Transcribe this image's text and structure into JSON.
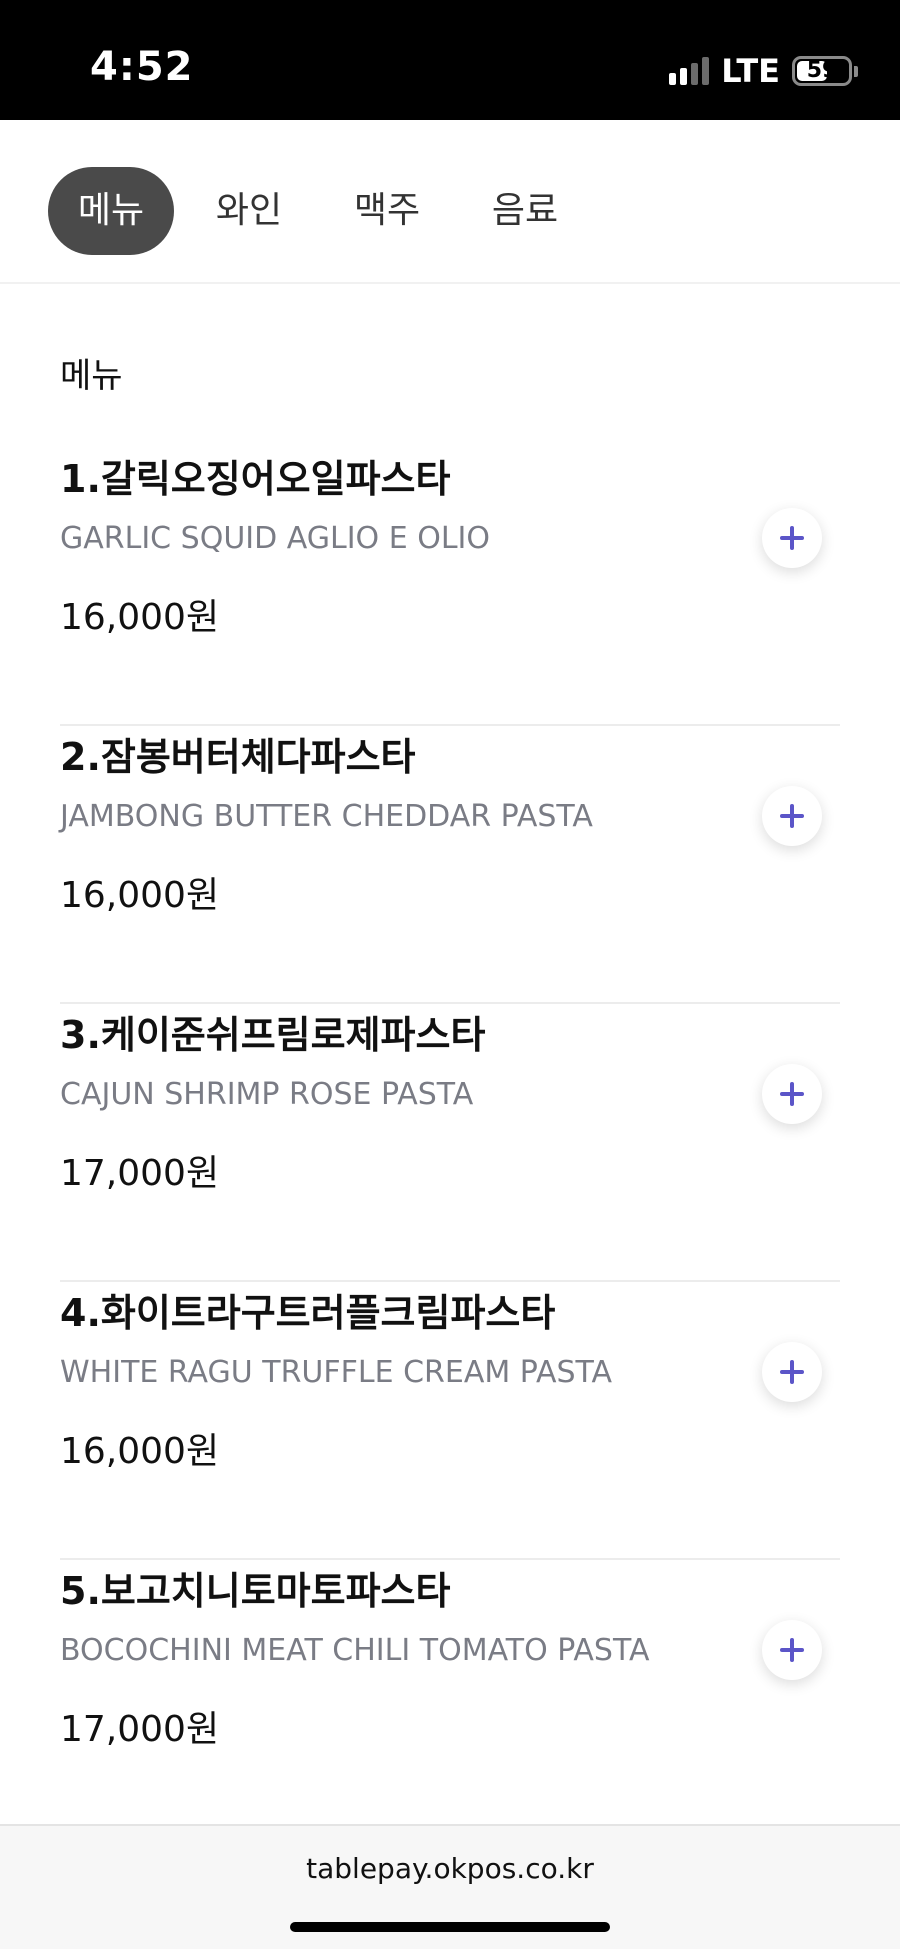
{
  "status_bar": {
    "time": "4:52",
    "network": "LTE",
    "battery": "59",
    "battery_level_pct": 59,
    "signal_bars_active": 2,
    "signal_bars_total": 4
  },
  "tabs": [
    {
      "label": "메뉴",
      "active": true
    },
    {
      "label": "와인",
      "active": false
    },
    {
      "label": "맥주",
      "active": false
    },
    {
      "label": "음료",
      "active": false
    }
  ],
  "section": {
    "title": "메뉴"
  },
  "menu_items": [
    {
      "name": "1.갈릭오징어오일파스타",
      "english": "GARLIC SQUID AGLIO E OLIO",
      "price": "16,000원"
    },
    {
      "name": "2.잠봉버터체다파스타",
      "english": "JAMBONG BUTTER CHEDDAR PASTA",
      "price": "16,000원"
    },
    {
      "name": "3.케이준쉬프림로제파스타",
      "english": "CAJUN SHRIMP ROSE PASTA",
      "price": "17,000원"
    },
    {
      "name": "4.화이트라구트러플크림파스타",
      "english": "WHITE RAGU TRUFFLE CREAM PASTA",
      "price": "16,000원"
    },
    {
      "name": "5.보고치니토마토파스타",
      "english": "BOCOCHINI MEAT CHILI TOMATO PASTA",
      "price": "17,000원"
    }
  ],
  "browser": {
    "url": "tablepay.okpos.co.kr"
  },
  "colors": {
    "accent": "#5b55c8",
    "active_tab_bg": "#4a4a4a",
    "subtext": "#7a7c85"
  }
}
